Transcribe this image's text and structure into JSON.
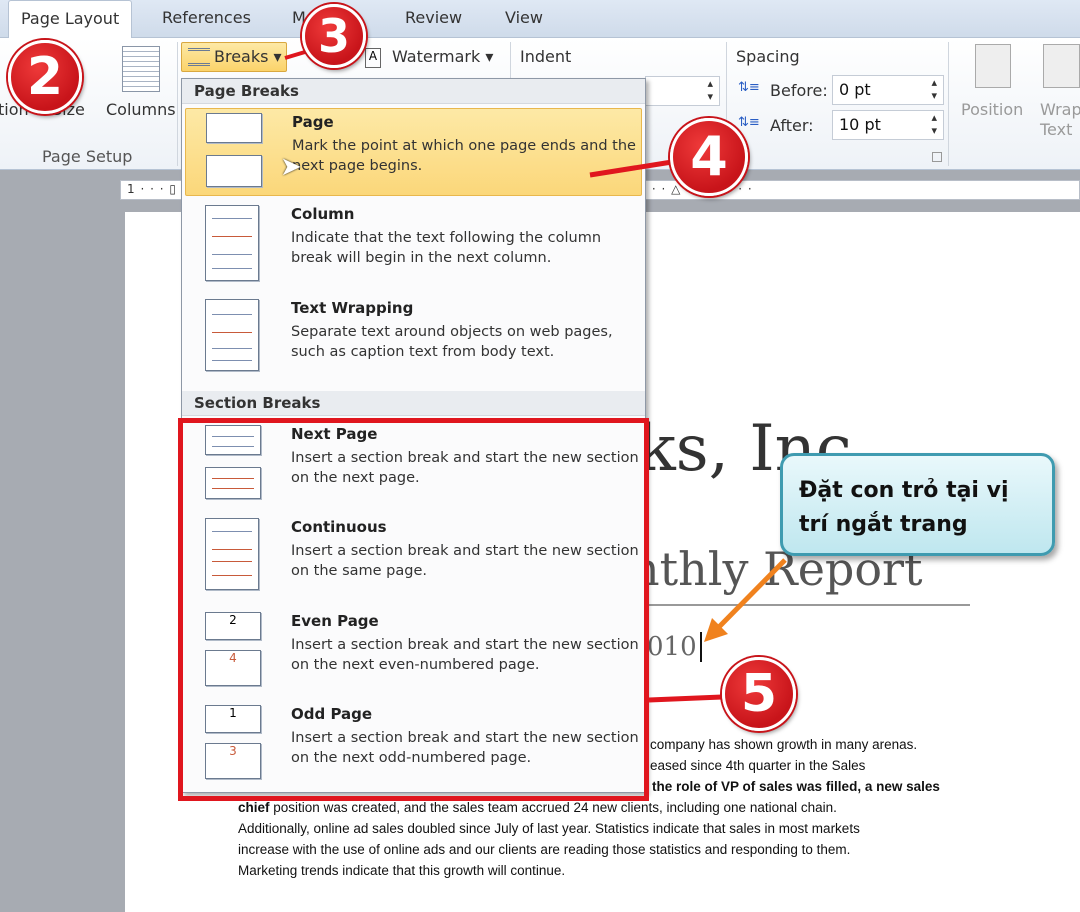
{
  "tabs": [
    "Page Layout",
    "References",
    "M",
    "Review",
    "View"
  ],
  "ribbon": {
    "orientation": "tion",
    "size": "Size",
    "columns": "Columns",
    "page_setup": "Page Setup",
    "breaks": "Breaks ▾",
    "watermark": "Watermark ▾",
    "indent": "Indent",
    "spacing": "Spacing",
    "before_label": "Before:",
    "before_value": "0 pt",
    "after_label": "After:",
    "after_value": "10 pt",
    "position": "Position",
    "wrap_text": "Wrap Text"
  },
  "ruler": "1 · · · ▯ · · · 1 · · · ▯ · · · 2 · · · ▯ · · · 3 · · · ▯ · · · 4 · · · ▯ · · · 5 · · · ▯ · · · 6 · · · △ · · · 7 · · ·",
  "menu": {
    "page_breaks_header": "Page Breaks",
    "section_breaks_header": "Section Breaks",
    "items": [
      {
        "title": "Page",
        "underline": "P",
        "desc": "Mark the point at which one page ends and the next page begins."
      },
      {
        "title": "Column",
        "underline": "C",
        "desc": "Indicate that the text following the column break will begin in the next column."
      },
      {
        "title": "Text Wrapping",
        "underline": "T",
        "desc": "Separate text around objects on web pages, such as caption text from body text."
      },
      {
        "title": "Next Page",
        "underline": "N",
        "desc": "Insert a section break and start the new section on the next page."
      },
      {
        "title": "Continuous",
        "underline": "o",
        "desc": "Insert a section break and start the new section on the same page."
      },
      {
        "title": "Even Page",
        "underline": "E",
        "desc": "Insert a section break and start the new section on the next even-numbered page."
      },
      {
        "title": "Odd Page",
        "underline": "d",
        "desc": "Insert a section break and start the new section on the next odd-numbered page."
      }
    ]
  },
  "document": {
    "title_fragment": "ks, Inc",
    "subtitle_fragment": "nthly Report",
    "date_fragment": "010",
    "lines": [
      "company has shown growth in many arenas.",
      "eased since 4th quarter in the Sales",
      "the role of VP of sales was filled, a new sales",
      "position was created, and the sales team accrued 24 new clients, including one national chain.",
      "Additionally, online ad sales doubled since July of last year. Statistics indicate that sales in most markets",
      "increase with the use of online ads and our clients are reading those statistics and responding to them.",
      "Marketing trends indicate that this growth will continue."
    ],
    "bold_word": "chief"
  },
  "annotations": {
    "steps": [
      "2",
      "3",
      "4",
      "5"
    ],
    "callout": "Đặt con trỏ tại vị trí ngắt trang",
    "red": "#e0161e",
    "arrow": "#f0821e"
  }
}
